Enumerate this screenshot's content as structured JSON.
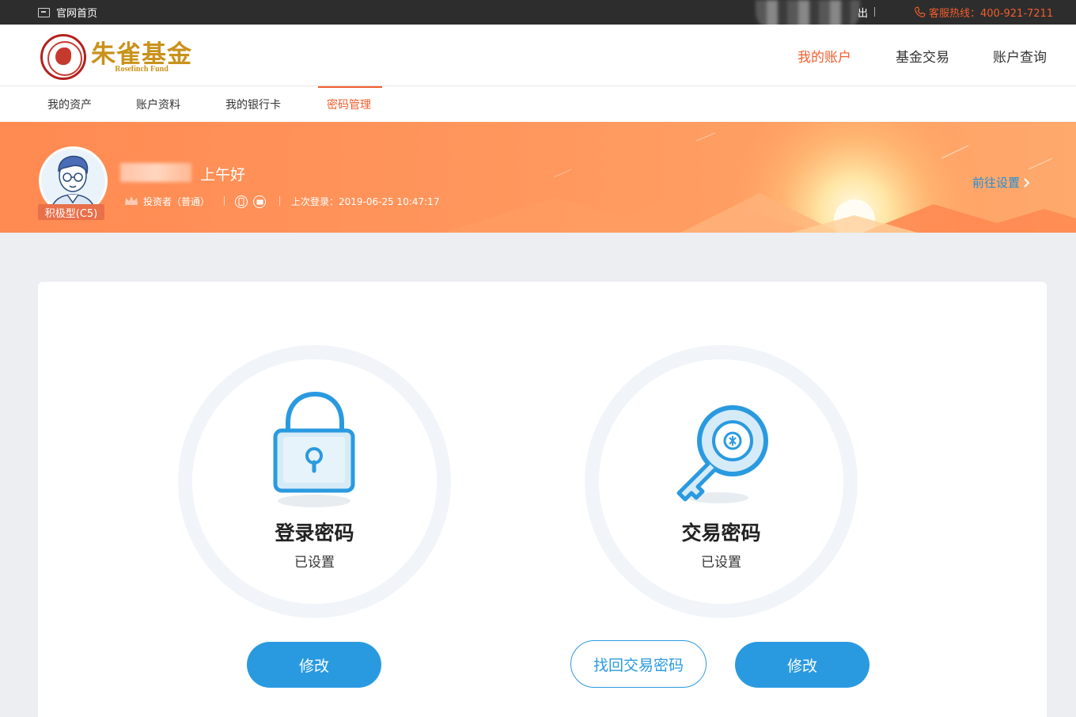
{
  "topbar": {
    "home_label": "官网首页",
    "logout_label": "出",
    "hotline_label": "客服热线：400-921-7211"
  },
  "brand": {
    "name_cn": "朱雀基金",
    "name_en": "Rosefinch Fund"
  },
  "main_nav": [
    {
      "label": "我的账户",
      "active": true
    },
    {
      "label": "基金交易",
      "active": false
    },
    {
      "label": "账户查询",
      "active": false
    }
  ],
  "sub_nav": [
    {
      "label": "我的资产",
      "active": false
    },
    {
      "label": "账户资料",
      "active": false
    },
    {
      "label": "我的银行卡",
      "active": false
    },
    {
      "label": "密码管理",
      "active": true
    }
  ],
  "profile": {
    "risk_badge": "积极型(C5)",
    "greeting": "上午好",
    "investor_type": "投资者（普通）",
    "last_login": "上次登录：2019-06-25 10:47:17",
    "goto_settings": "前往设置"
  },
  "passwords": [
    {
      "title": "登录密码",
      "status": "已设置",
      "icon": "lock-icon",
      "actions": [
        "修改"
      ]
    },
    {
      "title": "交易密码",
      "status": "已设置",
      "icon": "key-icon",
      "actions": [
        "找回交易密码",
        "修改"
      ]
    }
  ],
  "colors": {
    "accent": "#f25d2c",
    "primary_button": "#2a9ae0",
    "banner": "#ff8a52",
    "topbar": "#2d2d2d"
  }
}
